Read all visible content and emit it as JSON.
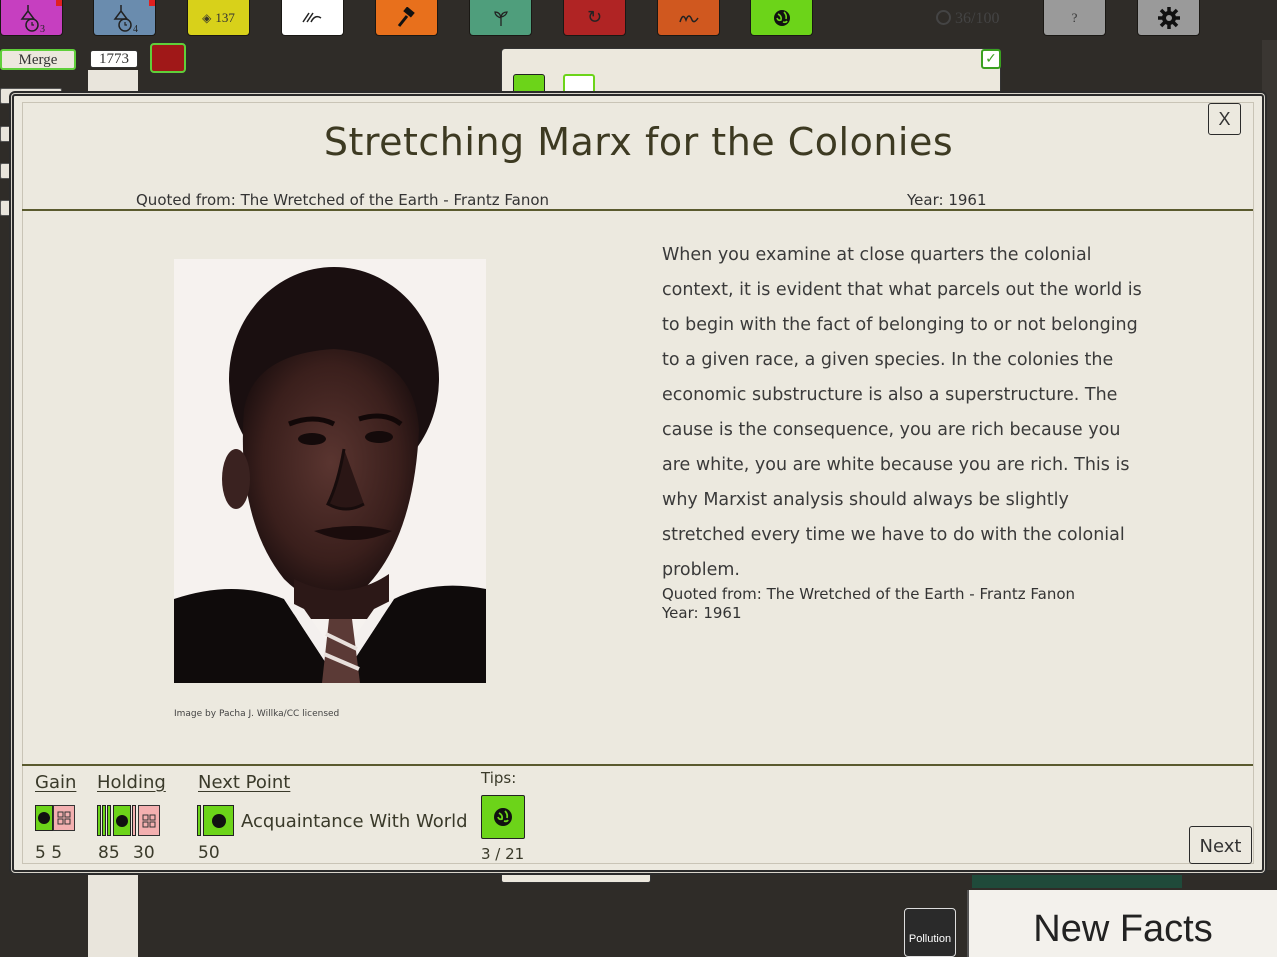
{
  "toolbar": {
    "buttons": [
      {
        "name": "research-a",
        "color": "#c63fc0",
        "text": "3"
      },
      {
        "name": "research-b",
        "color": "#6a8cae",
        "text": "4"
      },
      {
        "name": "resource-count",
        "color": "#d8d11a",
        "text": "137"
      },
      {
        "name": "writing",
        "color": "#ffffff",
        "text": ""
      },
      {
        "name": "hammer",
        "color": "#e8701c",
        "text": ""
      },
      {
        "name": "plant",
        "color": "#4f9e7c",
        "text": ""
      },
      {
        "name": "cycle",
        "color": "#b02424",
        "text": ""
      },
      {
        "name": "script",
        "color": "#d0581f",
        "text": ""
      },
      {
        "name": "world",
        "color": "#6cd419",
        "text": ""
      },
      {
        "name": "help",
        "color": "#9a9a9a",
        "text": "?"
      },
      {
        "name": "settings",
        "color": "#9a9a9a",
        "text": ""
      }
    ],
    "progress": "36/100"
  },
  "background": {
    "merge_label": "Merge",
    "year": "1773",
    "pollution_label": "Pollution",
    "new_facts_label": "New Facts"
  },
  "modal": {
    "close_label": "X",
    "title": "Stretching Marx for the Colonies",
    "quoted_from": "Quoted from: The Wretched of the Earth - Frantz Fanon",
    "year": "Year: 1961",
    "image_credit": "Image by Pacha J. Willka/CC licensed",
    "quote": "When you examine at close quarters the colonial context, it is evident that what parcels out the world is to begin with the fact of belonging to or not belonging to a given race, a given species. In the colonies the economic substructure is also a superstructure. The cause is the consequence, you are rich because you are white, you are white because you are rich. This is why Marxist analysis should always be slightly stretched every time we have to do with the colonial problem.",
    "source_line1": "Quoted from: The Wretched of the Earth - Frantz Fanon",
    "source_line2": "Year: 1961",
    "footer": {
      "gain_label": "Gain",
      "gain_values": "5 5",
      "holding_label": "Holding",
      "holding_value_a": "85",
      "holding_value_b": "30",
      "next_point_label": "Next Point",
      "next_point_name": "Acquaintance With World",
      "next_point_value": "50",
      "tips_label": "Tips:",
      "tips_count": "3 / 21",
      "next_label": "Next"
    }
  },
  "colors": {
    "world_green": "#6cd419",
    "modal_bg": "#ece9df",
    "accent_line": "#5a5a2e"
  }
}
